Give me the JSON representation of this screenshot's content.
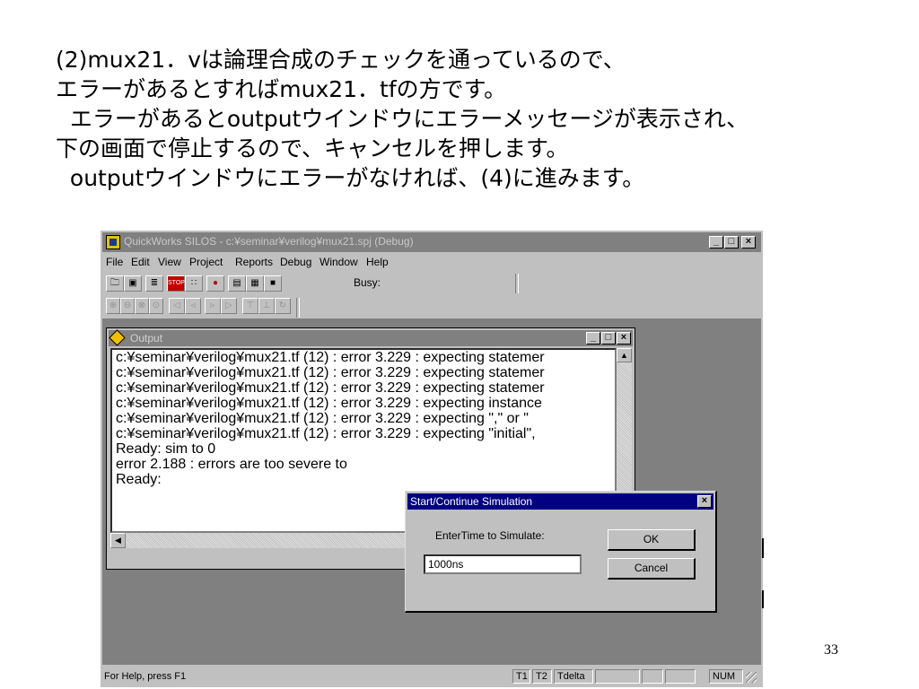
{
  "slide": {
    "lines": [
      "(2)mux21．vは論理合成のチェックを通っているので、",
      "エラーがあるとすればmux21．tfの方です。",
      "  エラーがあるとoutputウインドウにエラーメッセージが表示され、",
      "下の画面で停止するので、キャンセルを押します。",
      "  outputウインドウにエラーがなければ、(4)に進みます。"
    ],
    "page_number": "33"
  },
  "app": {
    "title": "QuickWorks SILOS - c:¥seminar¥verilog¥mux21.spj (Debug)",
    "window_buttons": [
      "_",
      "□",
      "×"
    ],
    "menu": [
      "File",
      "Edit",
      "View",
      "Project",
      "Reports",
      "Debug",
      "Window",
      "Help"
    ],
    "busy_label": "Busy:",
    "output": {
      "title": "Output",
      "lines": [
        "c:¥seminar¥verilog¥mux21.tf (12) : error 3.229 : expecting statemer",
        "c:¥seminar¥verilog¥mux21.tf (12) : error 3.229 : expecting statemer",
        "c:¥seminar¥verilog¥mux21.tf (12) : error 3.229 : expecting statemer",
        "c:¥seminar¥verilog¥mux21.tf (12) : error 3.229 : expecting instance",
        "c:¥seminar¥verilog¥mux21.tf (12) : error 3.229 : expecting \",\" or \"",
        "c:¥seminar¥verilog¥mux21.tf (12) : error 3.229 : expecting \"initial\",",
        "Ready: sim to 0",
        "error 2.188 : errors are too severe to",
        "Ready:"
      ]
    },
    "status": {
      "help": "For Help, press F1",
      "t1": "T1",
      "t2": "T2",
      "tdelta": "Tdelta",
      "num": "NUM"
    }
  },
  "dialog": {
    "title": "Start/Continue Simulation",
    "label": "EnterTime to Simulate:",
    "input_value": "1000ns",
    "ok_label": "OK",
    "cancel_label": "Cancel",
    "close": "×"
  }
}
